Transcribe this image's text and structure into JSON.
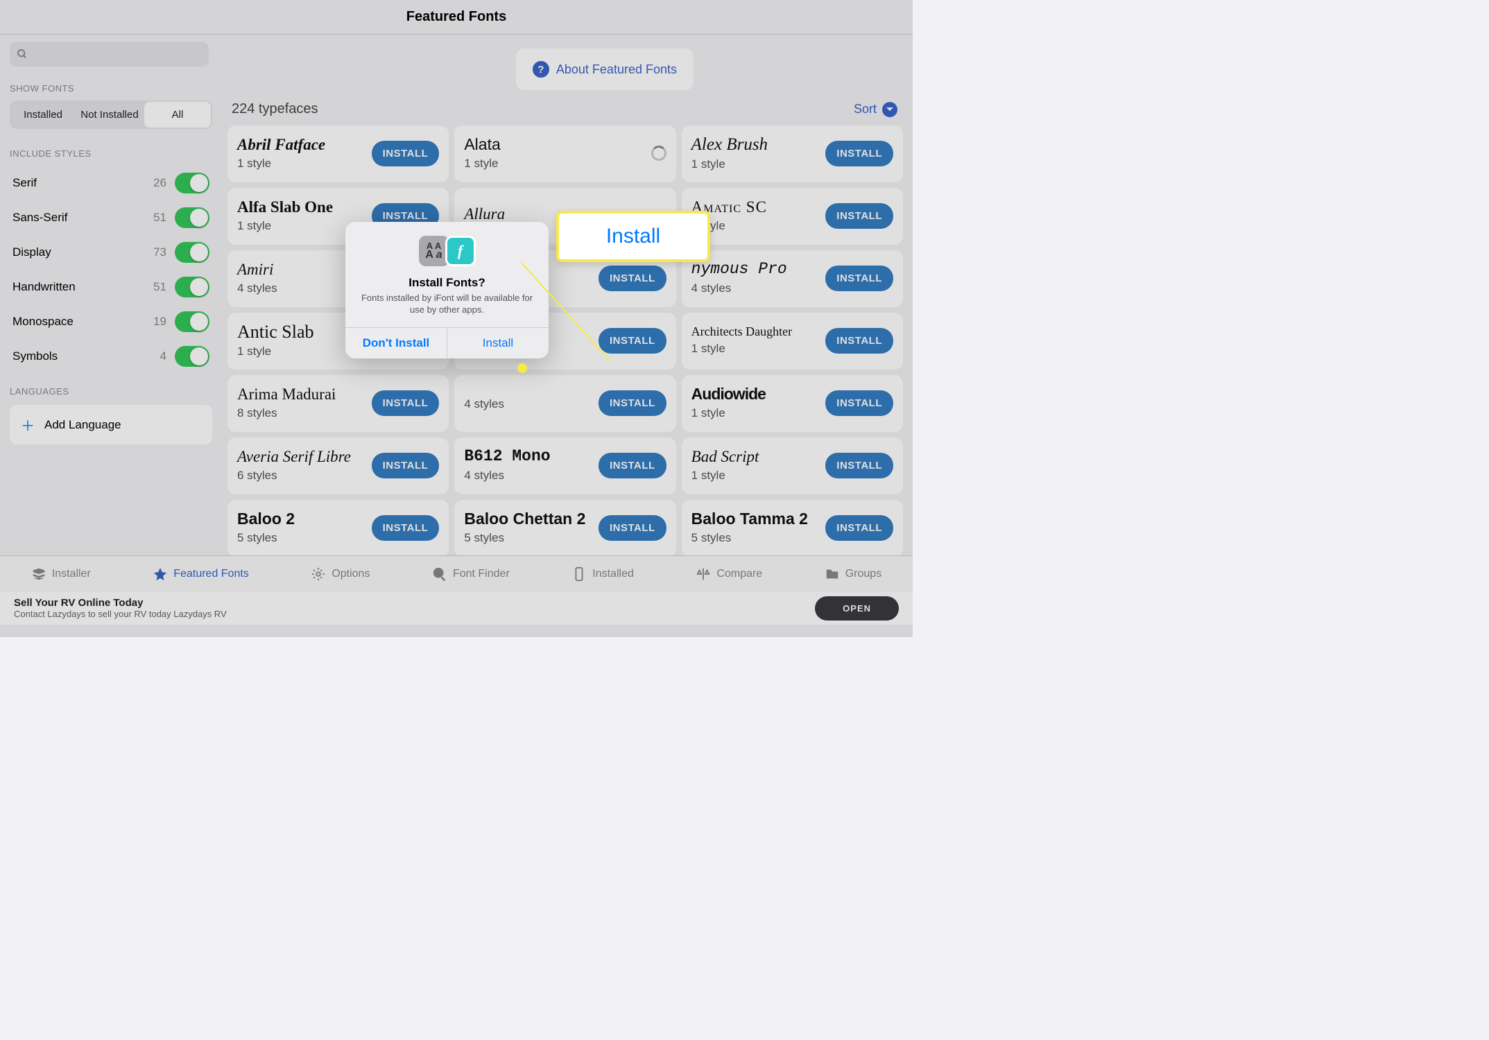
{
  "header": {
    "title": "Featured Fonts"
  },
  "about": {
    "label": "About Featured Fonts"
  },
  "sidebar": {
    "show_fonts_label": "SHOW FONTS",
    "segments": [
      "Installed",
      "Not Installed",
      "All"
    ],
    "active_segment": 2,
    "include_styles_label": "INCLUDE STYLES",
    "styles": [
      {
        "name": "Serif",
        "count": 26
      },
      {
        "name": "Sans-Serif",
        "count": 51
      },
      {
        "name": "Display",
        "count": 73
      },
      {
        "name": "Handwritten",
        "count": 51
      },
      {
        "name": "Monospace",
        "count": 19
      },
      {
        "name": "Symbols",
        "count": 4
      }
    ],
    "languages_label": "LANGUAGES",
    "add_language_label": "Add Language"
  },
  "content": {
    "count_label": "224 typefaces",
    "sort_label": "Sort",
    "install_label": "INSTALL",
    "fonts": [
      {
        "name": "Abril Fatface",
        "styles": "1 style",
        "cls": "f-abril",
        "state": "install"
      },
      {
        "name": "Alata",
        "styles": "1 style",
        "cls": "f-alata",
        "state": "loading"
      },
      {
        "name": "Alex Brush",
        "styles": "1 style",
        "cls": "f-alexbrush",
        "state": "install"
      },
      {
        "name": "Alfa Slab One",
        "styles": "1 style",
        "cls": "f-alfa",
        "state": "install"
      },
      {
        "name": "Allura",
        "styles": "",
        "cls": "f-allura",
        "state": "none"
      },
      {
        "name": "Amatic SC",
        "styles": "1 style",
        "cls": "f-amatic",
        "state": "install"
      },
      {
        "name": "Amiri",
        "styles": "4 styles",
        "cls": "f-amiri",
        "state": "none"
      },
      {
        "name": "",
        "styles": "",
        "cls": "",
        "state": "install_only"
      },
      {
        "name": "nymous Pro",
        "styles": "4 styles",
        "cls": "f-anonymous",
        "state": "install"
      },
      {
        "name": "Antic Slab",
        "styles": "1 style",
        "cls": "f-antic",
        "state": "none"
      },
      {
        "name": "",
        "styles": "",
        "cls": "",
        "state": "install_only"
      },
      {
        "name": "Architects Daughter",
        "styles": "1 style",
        "cls": "f-architects",
        "state": "install"
      },
      {
        "name": "Arima Madurai",
        "styles": "8 styles",
        "cls": "f-arima",
        "state": "install"
      },
      {
        "name": "",
        "styles": "4 styles",
        "cls": "",
        "state": "install"
      },
      {
        "name": "Audiowide",
        "styles": "1 style",
        "cls": "f-audiowide",
        "state": "install"
      },
      {
        "name": "Averia Serif Libre",
        "styles": "6 styles",
        "cls": "f-averia",
        "state": "install"
      },
      {
        "name": "B612 Mono",
        "styles": "4 styles",
        "cls": "f-b612",
        "state": "install"
      },
      {
        "name": "Bad Script",
        "styles": "1 style",
        "cls": "f-bad",
        "state": "install"
      },
      {
        "name": "Baloo 2",
        "styles": "5 styles",
        "cls": "f-baloo",
        "state": "install"
      },
      {
        "name": "Baloo Chettan 2",
        "styles": "5 styles",
        "cls": "f-baloo",
        "state": "install"
      },
      {
        "name": "Baloo Tamma 2",
        "styles": "5 styles",
        "cls": "f-baloo",
        "state": "install"
      }
    ]
  },
  "tabs": [
    {
      "icon": "installer",
      "label": "Installer"
    },
    {
      "icon": "star",
      "label": "Featured Fonts"
    },
    {
      "icon": "gear",
      "label": "Options"
    },
    {
      "icon": "search",
      "label": "Font Finder"
    },
    {
      "icon": "phone",
      "label": "Installed"
    },
    {
      "icon": "scale",
      "label": "Compare"
    },
    {
      "icon": "folder",
      "label": "Groups"
    }
  ],
  "active_tab": 1,
  "ad": {
    "title": "Sell Your RV Online Today",
    "subtitle": "Contact Lazydays to sell your RV today Lazydays RV",
    "open_label": "OPEN"
  },
  "modal": {
    "title": "Install Fonts?",
    "message": "Fonts installed by iFont will be available for use by other apps.",
    "dont_label": "Don't Install",
    "install_label": "Install"
  },
  "callout": {
    "label": "Install"
  }
}
